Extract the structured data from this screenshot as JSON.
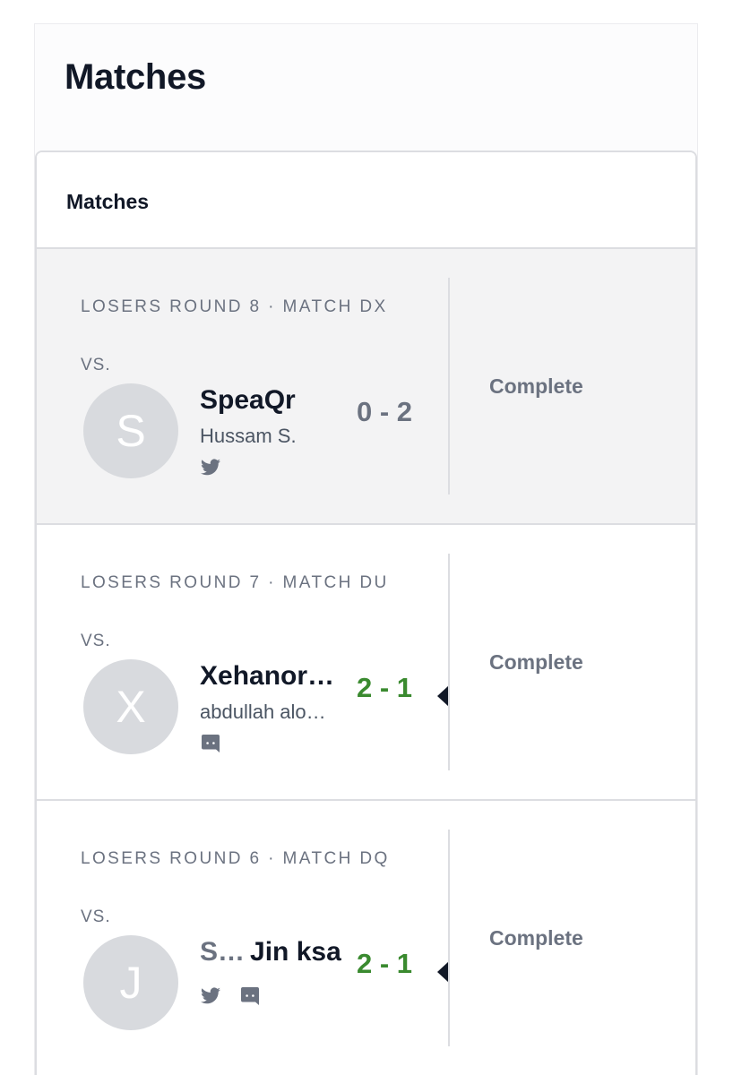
{
  "page": {
    "title": "Matches"
  },
  "panel": {
    "title": "Matches"
  },
  "matches": [
    {
      "round": "LOSERS ROUND 8 · MATCH DX",
      "vs": "VS.",
      "avatar_letter": "S",
      "player_name": "SpeaQr",
      "player_real": "Hussam S.",
      "score": "0 - 2",
      "status": "Complete",
      "socials": [
        "twitter-icon"
      ]
    },
    {
      "round": "LOSERS ROUND 7 · MATCH DU",
      "vs": "VS.",
      "avatar_letter": "X",
      "player_name": "Xehanor…",
      "player_real": "abdullah alo…",
      "score": "2 - 1",
      "status": "Complete",
      "socials": [
        "discord-icon"
      ]
    },
    {
      "round": "LOSERS ROUND 6 · MATCH DQ",
      "vs": "VS.",
      "avatar_letter": "J",
      "player_prefix": "S…",
      "player_name": "Jin ksa",
      "score": "2 - 1",
      "status": "Complete",
      "socials": [
        "twitter-icon",
        "discord-icon"
      ]
    }
  ],
  "colors": {
    "win_score": "#3a8a2f",
    "neutral_score": "#6b7280",
    "active_row_bg": "#f3f3f4"
  }
}
